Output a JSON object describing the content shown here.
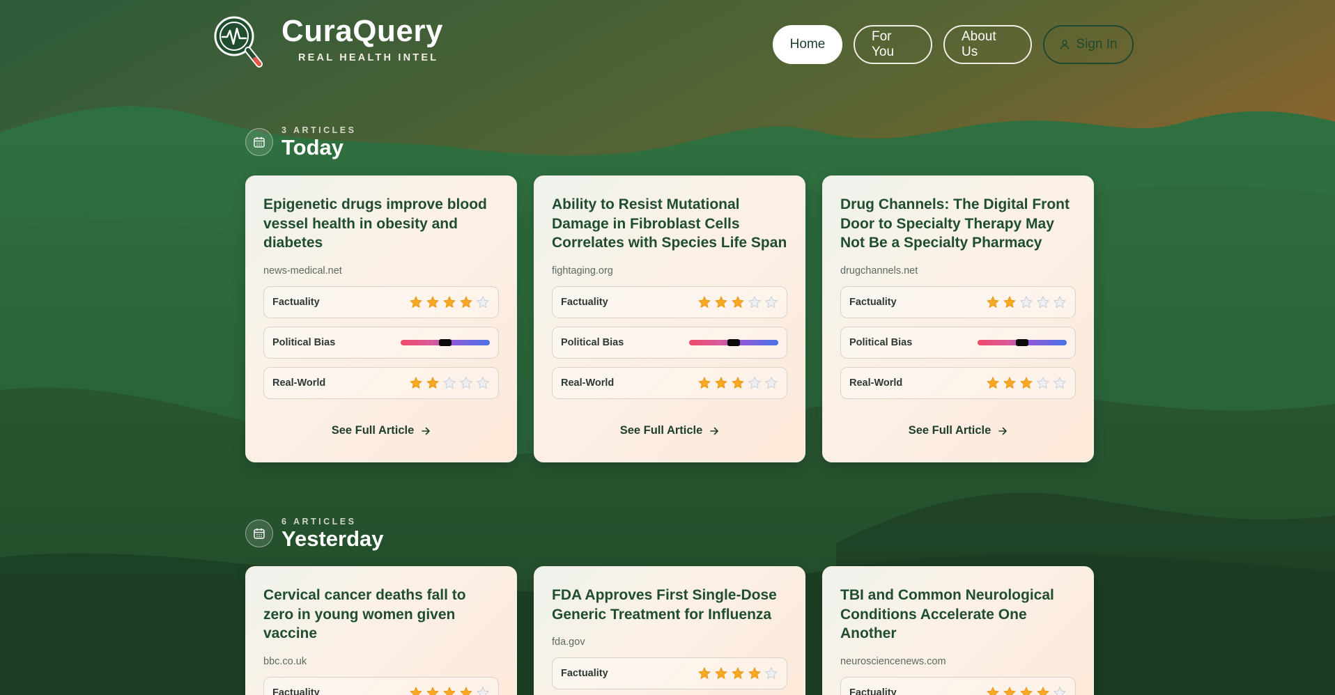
{
  "brand": {
    "name": "CuraQuery",
    "tagline": "REAL HEALTH INTEL"
  },
  "nav": [
    {
      "label": "Home",
      "active": true
    },
    {
      "label": "For You",
      "active": false
    },
    {
      "label": "About Us",
      "active": false
    },
    {
      "label": "Sign In",
      "active": false,
      "icon": "person-icon"
    }
  ],
  "metric_labels": {
    "factuality": "Factuality",
    "bias": "Political Bias",
    "realworld": "Real-World"
  },
  "sections": [
    {
      "count": "3 ARTICLES",
      "title": "Today",
      "articles": [
        {
          "title": "Epigenetic drugs improve blood vessel health in obesity and diabetes",
          "source": "news-medical.net",
          "factuality": 4,
          "bias": 0.5,
          "realworld": 2,
          "cta": "See Full Article"
        },
        {
          "title": "Ability to Resist Mutational Damage in Fibroblast Cells Correlates with Species Life Span",
          "source": "fightaging.org",
          "factuality": 3,
          "bias": 0.5,
          "realworld": 3,
          "cta": "See Full Article"
        },
        {
          "title": "Drug Channels: The Digital Front Door to Specialty Therapy May Not Be a Specialty Pharmacy",
          "source": "drugchannels.net",
          "factuality": 2,
          "bias": 0.5,
          "realworld": 3,
          "cta": "See Full Article"
        }
      ]
    },
    {
      "count": "6 ARTICLES",
      "title": "Yesterday",
      "articles": [
        {
          "title": "Cervical cancer deaths fall to zero in young women given vaccine",
          "source": "bbc.co.uk",
          "factuality": 4
        },
        {
          "title": "FDA Approves First Single-Dose Generic Treatment for Influenza",
          "source": "fda.gov",
          "factuality": 4
        },
        {
          "title": "TBI and Common Neurological Conditions Accelerate One Another",
          "source": "neurosciencenews.com",
          "factuality": 4
        }
      ]
    }
  ],
  "colors": {
    "accent": "#1f4d2e",
    "star_filled": "#f7a823",
    "star_empty": "#c9cdd4",
    "brand_red": "#e2564a"
  }
}
